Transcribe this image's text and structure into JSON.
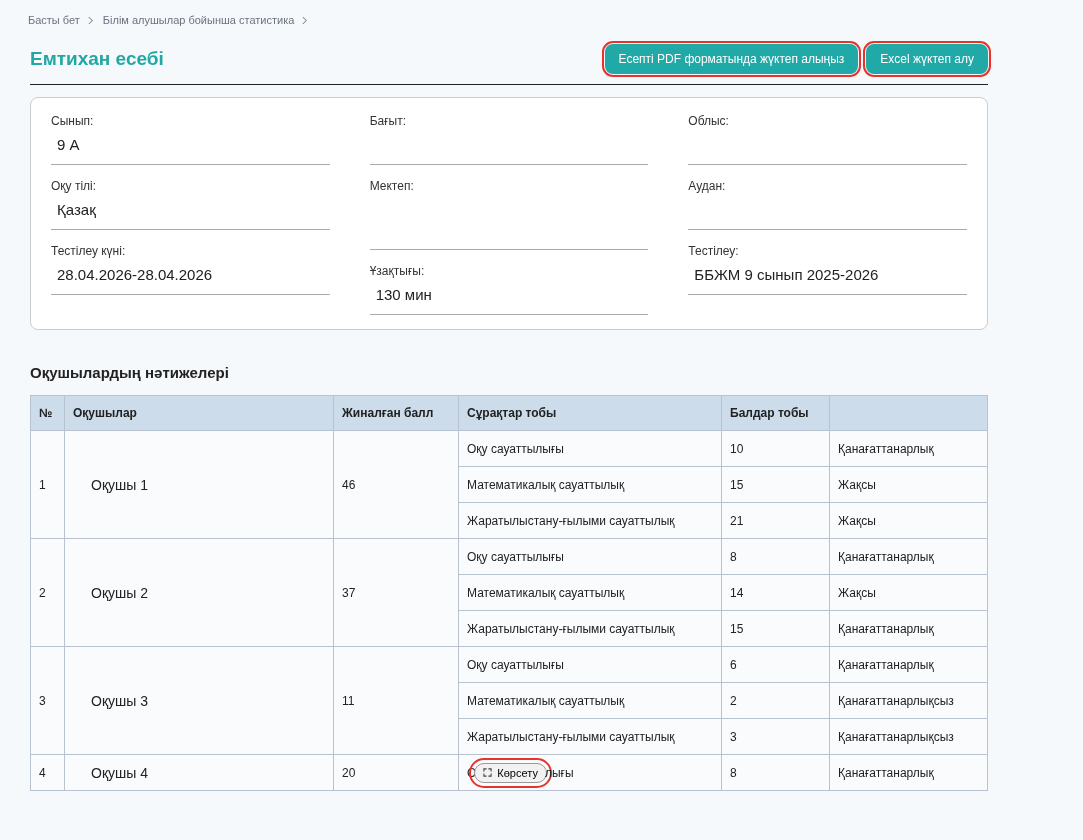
{
  "breadcrumbs": [
    "Басты бет",
    "Білім алушылар бойынша статистика"
  ],
  "title": "Емтихан есебі",
  "buttons": [
    {
      "label": "Есепті PDF форматында жүктеп алыңыз",
      "highlighted": true
    },
    {
      "label": "Excel жүктеп алу",
      "highlighted": true
    }
  ],
  "info_columns": [
    [
      {
        "label": "Сынып:",
        "value": "9 А"
      },
      {
        "label": "Оқу тілі:",
        "value": "Қазақ"
      },
      {
        "label": "Тестілеу күні:",
        "value": "28.04.2026-28.04.2026"
      }
    ],
    [
      {
        "label": "Бағыт:"
      },
      {
        "label": "Мектеп:",
        "tall": true
      },
      {
        "label": "Ұзақтығы:",
        "value": "130 мин"
      }
    ],
    [
      {
        "label": "Облыс:"
      },
      {
        "label": "Аудан:"
      },
      {
        "label": "Тестілеу:",
        "value": "ББЖМ 9 сынып 2025-2026"
      }
    ]
  ],
  "results_title": "Оқушылардың нәтижелері",
  "table": {
    "columns": [
      "№",
      "Оқушылар",
      "Жиналған балл",
      "Сұрақтар тобы",
      "Балдар тобы"
    ],
    "rows": [
      {
        "num": "1",
        "student": "Оқушы 1",
        "score": "46",
        "groups": [
          {
            "group": "Оқу сауаттылығы",
            "points": "10",
            "level": "Қанағаттанарлық"
          },
          {
            "group": "Математикалық сауаттылық",
            "points": "15",
            "level": "Жақсы"
          },
          {
            "group": "Жаратылыстану-ғылыми сауаттылық",
            "points": "21",
            "level": "Жақсы"
          }
        ]
      },
      {
        "num": "2",
        "student": "Оқушы 2",
        "score": "37",
        "groups": [
          {
            "group": "Оқу сауаттылығы",
            "points": "8",
            "level": "Қанағаттанарлық"
          },
          {
            "group": "Математикалық сауаттылық",
            "points": "14",
            "level": "Жақсы"
          },
          {
            "group": "Жаратылыстану-ғылыми сауаттылық",
            "points": "15",
            "level": "Қанағаттанарлық"
          }
        ]
      },
      {
        "num": "3",
        "student": "Оқушы 3",
        "score": "11",
        "groups": [
          {
            "group": "Оқу сауаттылығы",
            "points": "6",
            "level": "Қанағаттанарлық"
          },
          {
            "group": "Математикалық сауаттылық",
            "points": "2",
            "level": "Қанағаттанарлықсыз"
          },
          {
            "group": "Жаратылыстану-ғылыми сауаттылық",
            "points": "3",
            "level": "Қанағаттанарлықсыз"
          }
        ]
      },
      {
        "num": "4",
        "student": "Оқушы 4",
        "score": "20",
        "groups": [
          {
            "group_parts": [
              "О",
              "лығы"
            ],
            "points": "8",
            "level": "Қанағаттанарлық"
          }
        ]
      }
    ]
  },
  "show_button": {
    "label": "Көрсету",
    "highlighted": true
  }
}
